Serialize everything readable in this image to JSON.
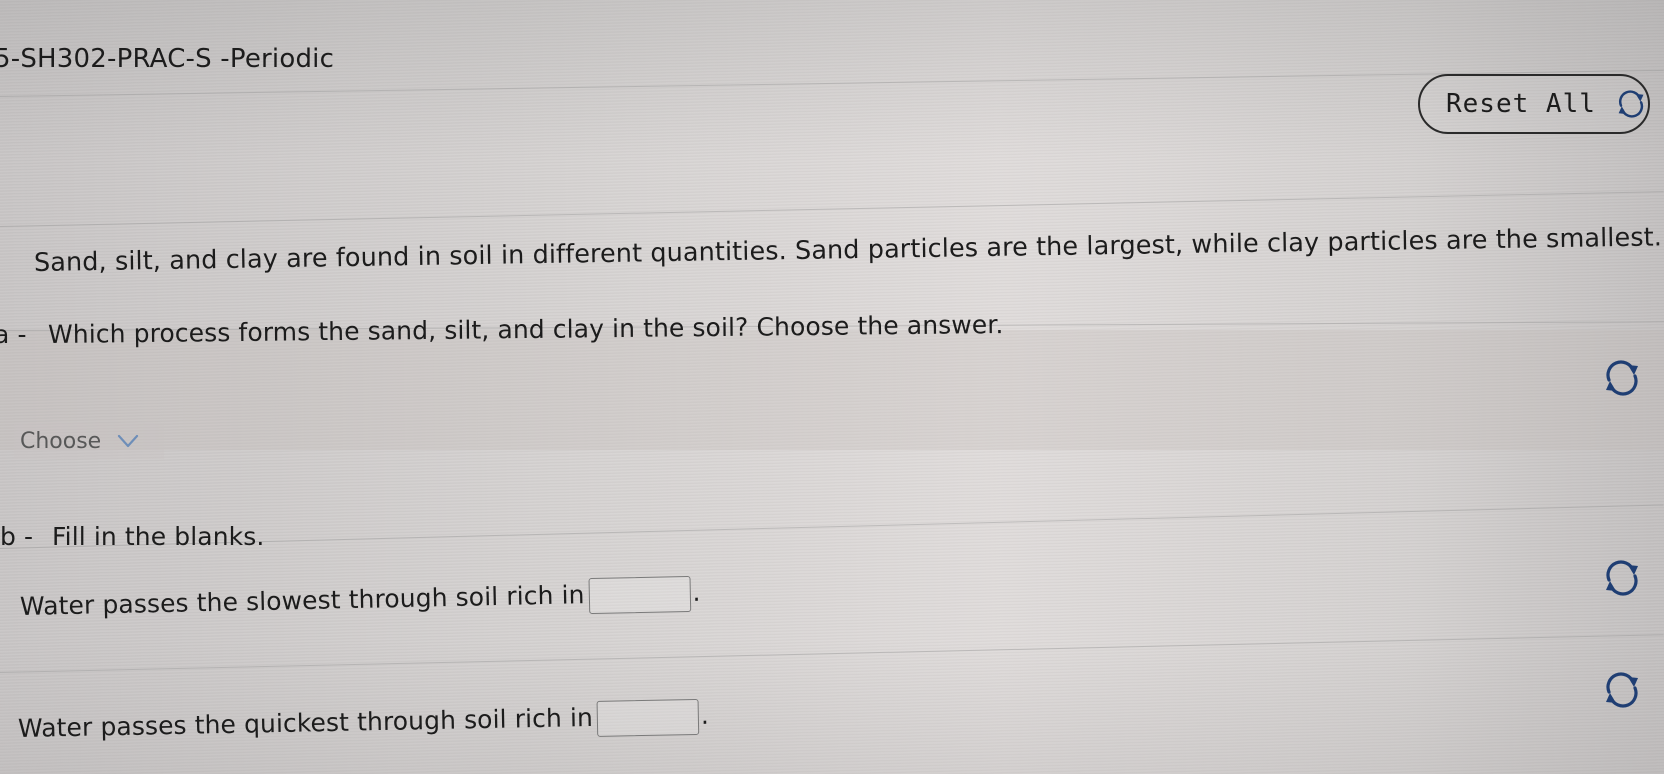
{
  "header": {
    "page_title": "5-SH302-PRAC-S -Periodic",
    "reset_label": "Reset All"
  },
  "passage": "Sand, silt, and clay are found in soil in different quantities. Sand particles are the largest, while clay particles are the smallest.",
  "question_a": {
    "marker": "a -",
    "prompt": "Which process forms the sand, silt, and clay in the soil? Choose the answer.",
    "select_value": "Choose"
  },
  "question_b": {
    "marker": "b -",
    "prompt": "Fill in the blanks.",
    "blanks": [
      {
        "text": "Water passes the slowest through soil rich in",
        "value": "",
        "end": "."
      },
      {
        "text": "Water passes the quickest through soil rich in",
        "value": "",
        "end": "."
      }
    ]
  },
  "icons": {
    "reset": "refresh-icon",
    "question_reset": "refresh-icon",
    "select_toggle": "chevron-down-icon"
  }
}
